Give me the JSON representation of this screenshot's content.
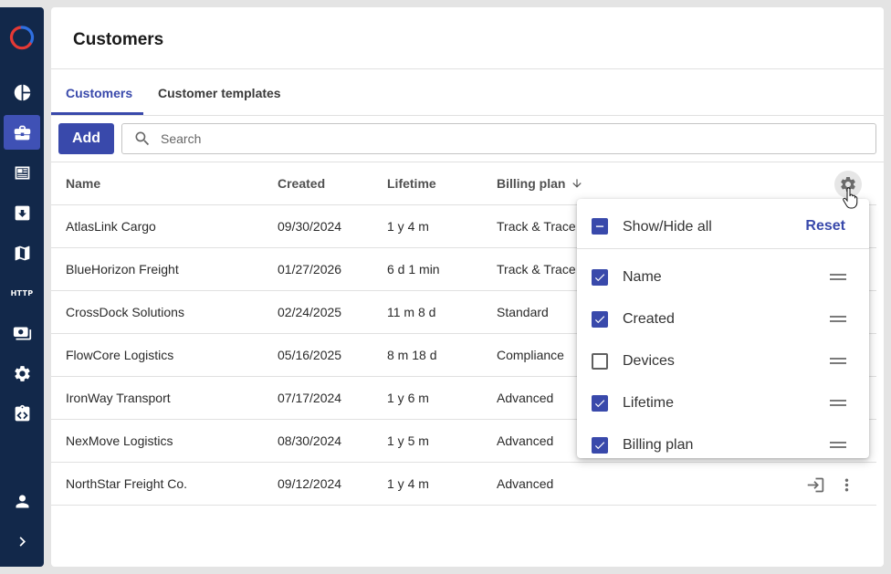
{
  "page": {
    "title": "Customers"
  },
  "tabs": [
    {
      "label": "Customers",
      "active": true
    },
    {
      "label": "Customer templates",
      "active": false
    }
  ],
  "toolbar": {
    "add_label": "Add",
    "search_placeholder": "Search",
    "search_value": ""
  },
  "table": {
    "columns": [
      {
        "label": "Name"
      },
      {
        "label": "Created"
      },
      {
        "label": "Lifetime"
      },
      {
        "label": "Billing plan",
        "sort": "descending"
      }
    ],
    "rows": [
      {
        "name": "AtlasLink Cargo",
        "created": "09/30/2024",
        "lifetime": "1 y 4 m",
        "plan": "Track & Trace"
      },
      {
        "name": "BlueHorizon Freight",
        "created": "01/27/2026",
        "lifetime": "6 d 1 min",
        "plan": "Track & Trace"
      },
      {
        "name": "CrossDock Solutions",
        "created": "02/24/2025",
        "lifetime": "11 m 8 d",
        "plan": "Standard"
      },
      {
        "name": "FlowCore Logistics",
        "created": "05/16/2025",
        "lifetime": "8 m 18 d",
        "plan": "Compliance"
      },
      {
        "name": "IronWay Transport",
        "created": "07/17/2024",
        "lifetime": "1 y 6 m",
        "plan": "Advanced"
      },
      {
        "name": "NexMove Logistics",
        "created": "08/30/2024",
        "lifetime": "1 y 5 m",
        "plan": "Advanced"
      },
      {
        "name": "NorthStar Freight Co.",
        "created": "09/12/2024",
        "lifetime": "1 y 4 m",
        "plan": "Advanced"
      }
    ]
  },
  "column_menu": {
    "show_hide_all_label": "Show/Hide all",
    "show_hide_all_state": "indeterminate",
    "reset_label": "Reset",
    "items": [
      {
        "label": "Name",
        "checked": true
      },
      {
        "label": "Created",
        "checked": true
      },
      {
        "label": "Devices",
        "checked": false
      },
      {
        "label": "Lifetime",
        "checked": true
      },
      {
        "label": "Billing plan",
        "checked": true
      }
    ]
  },
  "sidebar": {
    "items": [
      {
        "icon": "pie-chart-icon",
        "active": false
      },
      {
        "icon": "briefcase-icon",
        "active": true
      },
      {
        "icon": "newspaper-icon",
        "active": false
      },
      {
        "icon": "download-box-icon",
        "active": false
      },
      {
        "icon": "map-icon",
        "active": false
      },
      {
        "icon": "http-icon",
        "label": "HTTP",
        "active": false
      },
      {
        "icon": "payments-icon",
        "active": false
      },
      {
        "icon": "gear-icon",
        "active": false
      },
      {
        "icon": "api-icon",
        "active": false
      }
    ],
    "bottom": [
      {
        "icon": "user-icon"
      },
      {
        "icon": "chevron-right-icon"
      }
    ]
  },
  "colors": {
    "sidebar_bg": "#12284a",
    "accent": "#3949ab",
    "logo_red": "#e53935",
    "logo_blue": "#2f6fe0"
  }
}
